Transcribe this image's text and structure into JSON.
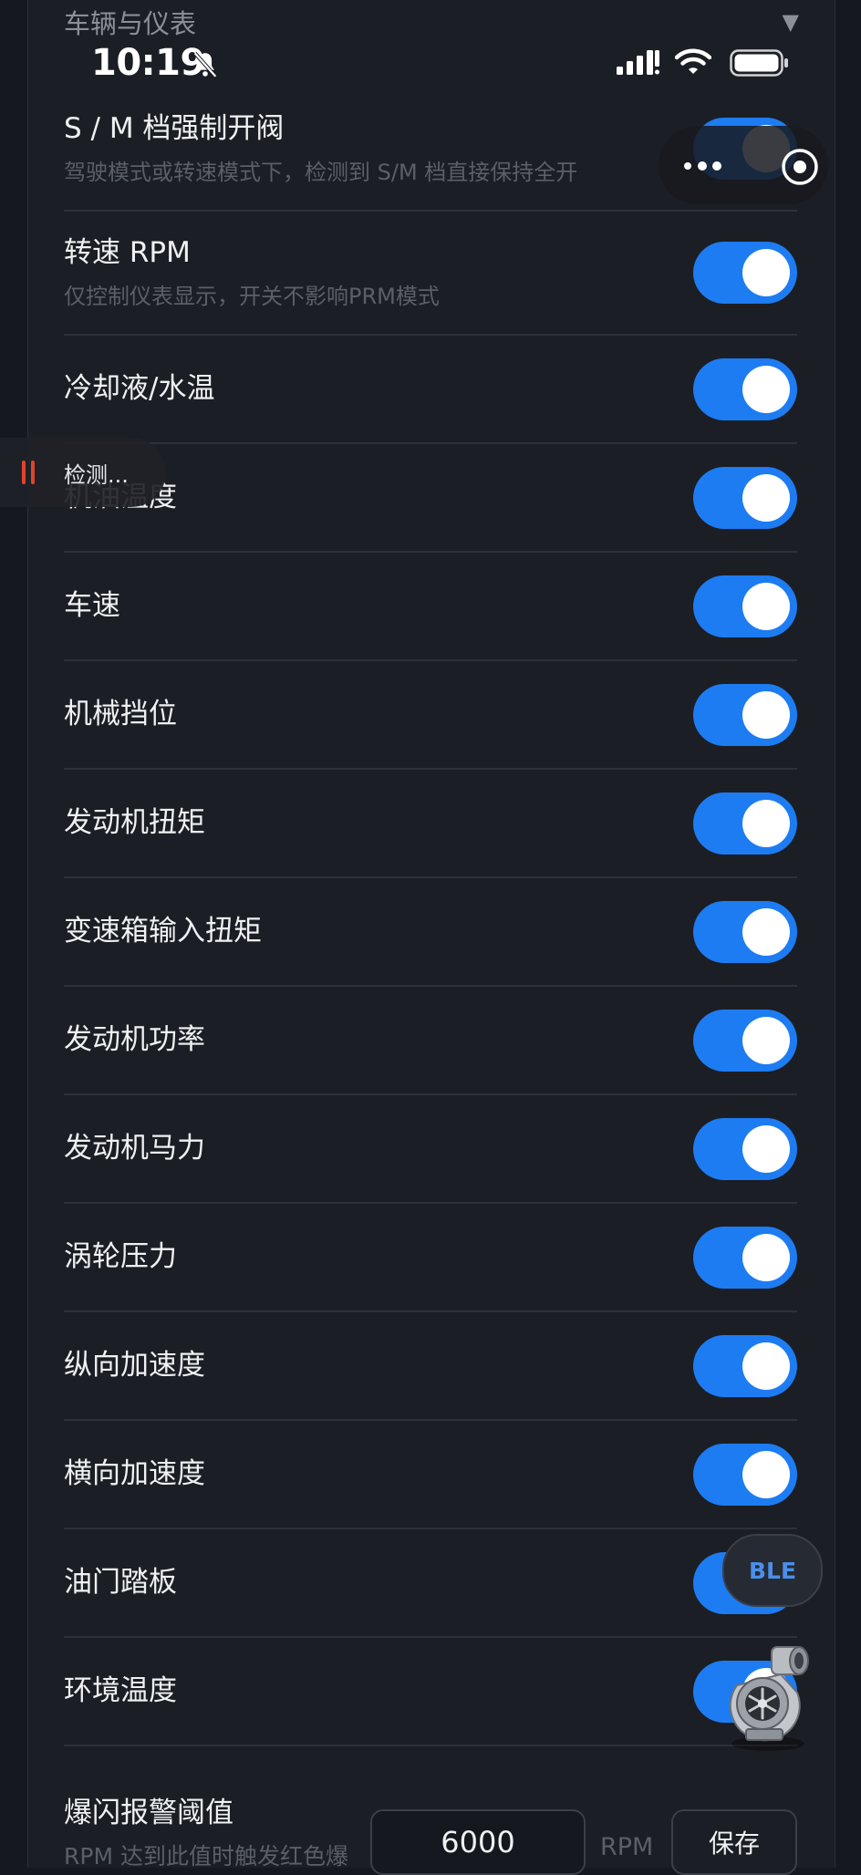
{
  "section": {
    "title": "车辆与仪表"
  },
  "status_bar": {
    "time": "10:19"
  },
  "rows": [
    {
      "label": "S / M 档强制开阀",
      "desc": "驾驶模式或转速模式下，检测到 S/M 档直接保持全开",
      "on": true
    },
    {
      "label": "转速 RPM",
      "desc": "仅控制仪表显示，开关不影响PRM模式",
      "on": true
    },
    {
      "label": "冷却液/水温",
      "on": true
    },
    {
      "label": "机油温度",
      "on": true
    },
    {
      "label": "车速",
      "on": true
    },
    {
      "label": "机械挡位",
      "on": true
    },
    {
      "label": "发动机扭矩",
      "on": true
    },
    {
      "label": "变速箱输入扭矩",
      "on": true
    },
    {
      "label": "发动机功率",
      "on": true
    },
    {
      "label": "发动机马力",
      "on": true
    },
    {
      "label": "涡轮压力",
      "on": true
    },
    {
      "label": "纵向加速度",
      "on": true
    },
    {
      "label": "横向加速度",
      "on": true
    },
    {
      "label": "油门踏板",
      "on": true
    },
    {
      "label": "环境温度",
      "on": true
    }
  ],
  "overlay": {
    "detect_label": "检测...",
    "ble_label": "BLE"
  },
  "threshold": {
    "label": "爆闪报警阈值",
    "desc": "RPM 达到此值时触发红色爆",
    "value": "6000",
    "unit": "RPM",
    "save_label": "保存"
  },
  "colors": {
    "toggle_on": "#1d7cf2",
    "background": "#1b1e24",
    "accent_red": "#e0442a",
    "ble_text": "#4a8fe8"
  }
}
